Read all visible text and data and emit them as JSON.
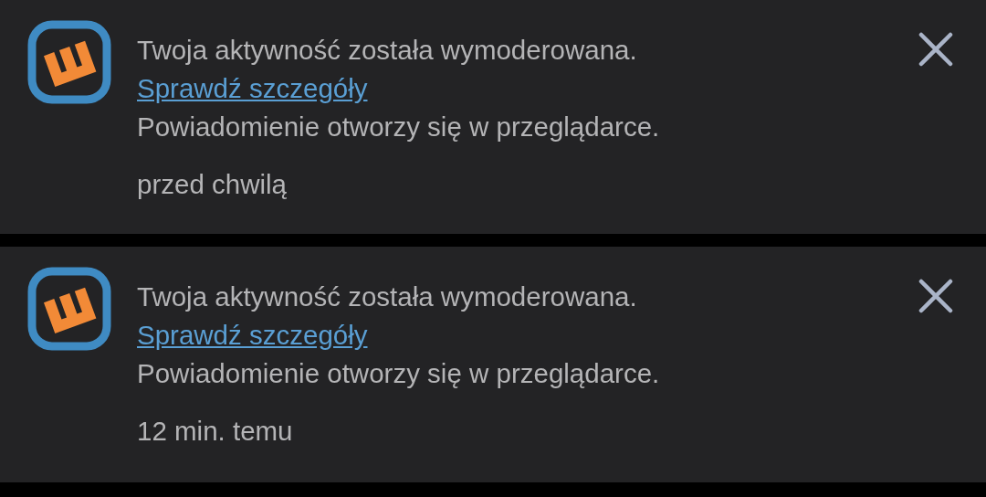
{
  "notifications": [
    {
      "message": "Twoja aktywność została wymoderowana.",
      "link": "Sprawdź szczegóły",
      "note": "Powiadomienie otworzy się w przeglądarce.",
      "time": "przed chwilą"
    },
    {
      "message": "Twoja aktywność została wymoderowana.",
      "link": "Sprawdź szczegóły",
      "note": "Powiadomienie otworzy się w przeglądarce.",
      "time": "12 min. temu"
    }
  ]
}
